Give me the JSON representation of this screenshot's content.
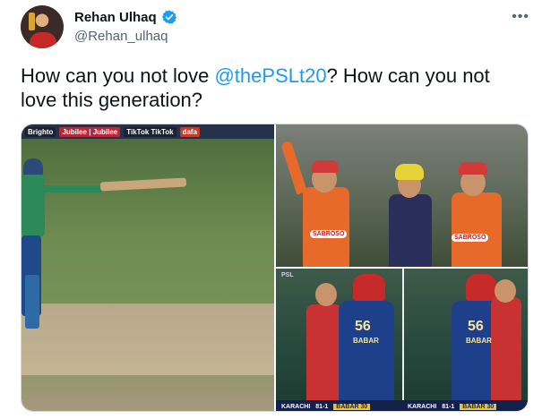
{
  "author": {
    "name": "Rehan Ulhaq",
    "handle": "@Rehan_ulhaq",
    "verified": true
  },
  "more_label": "•••",
  "tweet": {
    "text_before": "How can you not love ",
    "mention": "@thePSLt20",
    "text_after": "? How can you not love this generation?"
  },
  "media": {
    "left_ads": [
      "Brighto",
      "Jubilee | Jubilee",
      "TikTok  TikTok",
      "dafa"
    ],
    "top_right_sponsors": [
      "SABROSO",
      "SABROSO"
    ],
    "bottom_right_jersey_numbers": [
      "56",
      "56"
    ],
    "bottom_right_jersey_names": [
      "BABAR",
      "BABAR"
    ],
    "score_bar": {
      "team": "KARACHI",
      "score": "81-1",
      "batter": "BABAR 30"
    }
  },
  "colors": {
    "link": "#1d9bf0",
    "verified": "#1d9bf0",
    "secondary_text": "#536471"
  }
}
